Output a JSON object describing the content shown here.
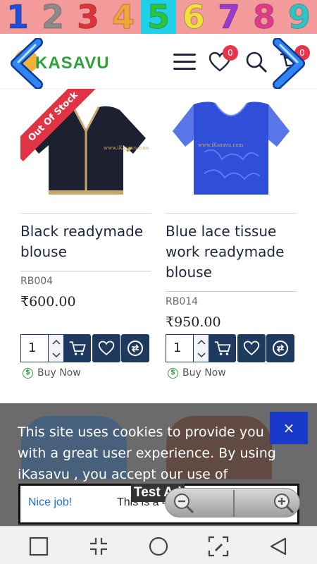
{
  "number_strip": {
    "digits": [
      "1",
      "2",
      "3",
      "4",
      "5",
      "6",
      "7",
      "8",
      "9"
    ],
    "colors": [
      {
        "bg": "#f39a9a",
        "fg": "#1f4fd6"
      },
      {
        "bg": "#f39a9a",
        "fg": "#8a8a8a"
      },
      {
        "bg": "#f39a9a",
        "fg": "#e0303a"
      },
      {
        "bg": "#f39a9a",
        "fg": "#f2a63a"
      },
      {
        "bg": "#1fd0e8",
        "fg": "#2ec43a"
      },
      {
        "bg": "#f39a9a",
        "fg": "#f0e03a"
      },
      {
        "bg": "#f39a9a",
        "fg": "#9a3ad0"
      },
      {
        "bg": "#f39a9a",
        "fg": "#e03a8a"
      },
      {
        "bg": "#f39a9a",
        "fg": "#2ec4c4"
      }
    ]
  },
  "header": {
    "logo_text": "KASAVU",
    "wishlist_count": "0",
    "cart_count": "0",
    "icons": [
      "menu-icon",
      "heart-icon",
      "search-icon",
      "cart-icon"
    ]
  },
  "products": [
    {
      "title": "Black readymade blouse",
      "sku": "RB004",
      "price": "₹600.00",
      "ribbon": "Out Of Stock",
      "watermark": "www.iKasavu.com",
      "quantity": "1",
      "buy_now": "Buy Now",
      "image_color": "#1c2030"
    },
    {
      "title": "Blue lace tissue work readymade blouse",
      "sku": "RB014",
      "price": "₹950.00",
      "ribbon": "",
      "watermark": "www.iKasavu.com",
      "quantity": "1",
      "buy_now": "Buy Now",
      "image_color": "#2f4fd8"
    }
  ],
  "cookie": {
    "text": "This site uses cookies to provide you with a great user experience. By using iKasavu , you accept our use of",
    "close_label": "×"
  },
  "ad": {
    "label": "Test Ad",
    "nice": "Nice job!",
    "body": "This is a 468x60 test ad."
  },
  "colors": {
    "accent_navy": "#1e3a5f",
    "logo_green": "#2ea13a",
    "badge_red": "#e8334a",
    "cookie_close_blue": "#1738c9"
  }
}
